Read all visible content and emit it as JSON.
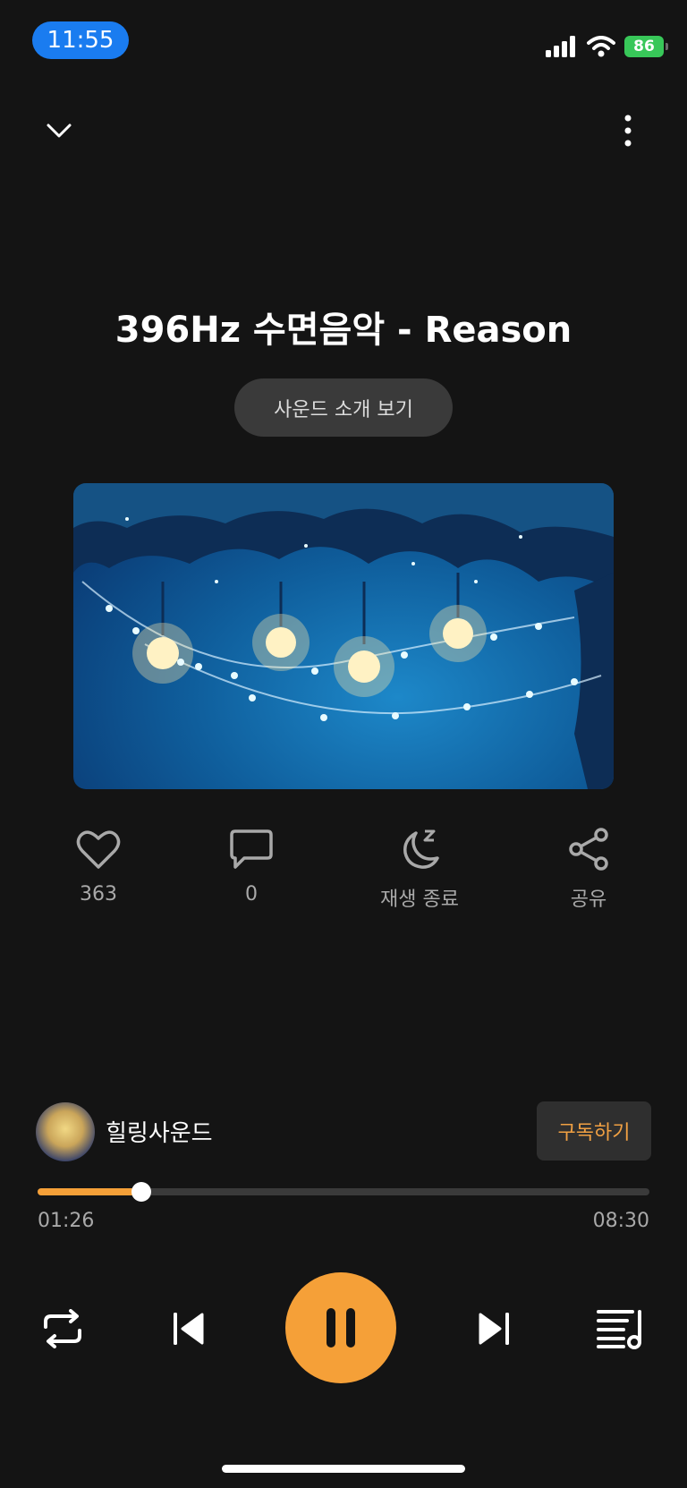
{
  "status_bar": {
    "time": "11:55",
    "battery": "86"
  },
  "track": {
    "title": "396Hz 수면음악 - Reason",
    "intro_button": "사운드 소개 보기"
  },
  "actions": [
    {
      "icon": "heart-icon",
      "label": "363"
    },
    {
      "icon": "comment-icon",
      "label": "0"
    },
    {
      "icon": "sleep-timer-icon",
      "label": "재생 종료"
    },
    {
      "icon": "share-icon",
      "label": "공유"
    }
  ],
  "channel": {
    "name": "힐링사운드",
    "subscribe_label": "구독하기"
  },
  "playback": {
    "elapsed": "01:26",
    "total": "08:30",
    "progress": 0.17
  },
  "colors": {
    "accent": "#f5a038",
    "background": "#141414"
  }
}
